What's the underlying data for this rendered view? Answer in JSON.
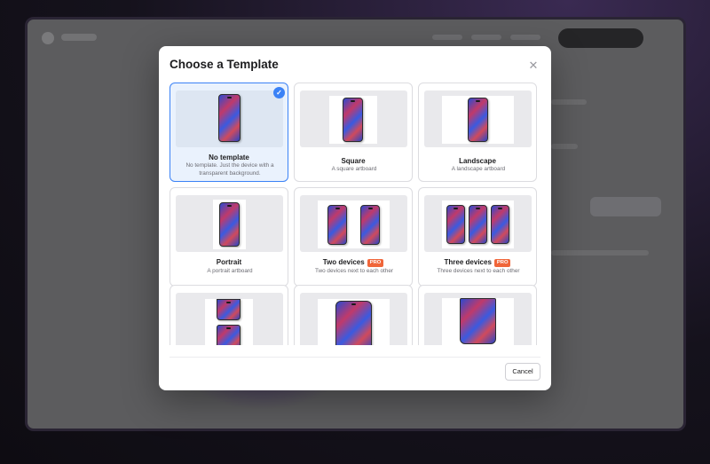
{
  "dialog": {
    "title": "Choose a Template",
    "close_icon": "close-icon",
    "cancel_label": "Cancel"
  },
  "templates": [
    {
      "title": "No template",
      "description": "No template. Just the device with a transparent background.",
      "selected": true,
      "pro": false
    },
    {
      "title": "Square",
      "description": "A square artboard",
      "selected": false,
      "pro": false
    },
    {
      "title": "Landscape",
      "description": "A landscape artboard",
      "selected": false,
      "pro": false
    },
    {
      "title": "Portrait",
      "description": "A portrait artboard",
      "selected": false,
      "pro": false
    },
    {
      "title": "Two devices",
      "description": "Two devices next to each other",
      "selected": false,
      "pro": true
    },
    {
      "title": "Three devices",
      "description": "Three devices next to each other",
      "selected": false,
      "pro": true
    },
    {
      "title": "",
      "description": "",
      "selected": false,
      "pro": false
    },
    {
      "title": "",
      "description": "",
      "selected": false,
      "pro": false
    },
    {
      "title": "",
      "description": "",
      "selected": false,
      "pro": false
    }
  ],
  "badges": {
    "pro_label": "PRO"
  },
  "colors": {
    "accent": "#3b82f6",
    "pro_badge": "#f0663a",
    "selected_bg": "#eaf2fd"
  },
  "icons": {
    "selected_check": "checkmark-icon"
  }
}
